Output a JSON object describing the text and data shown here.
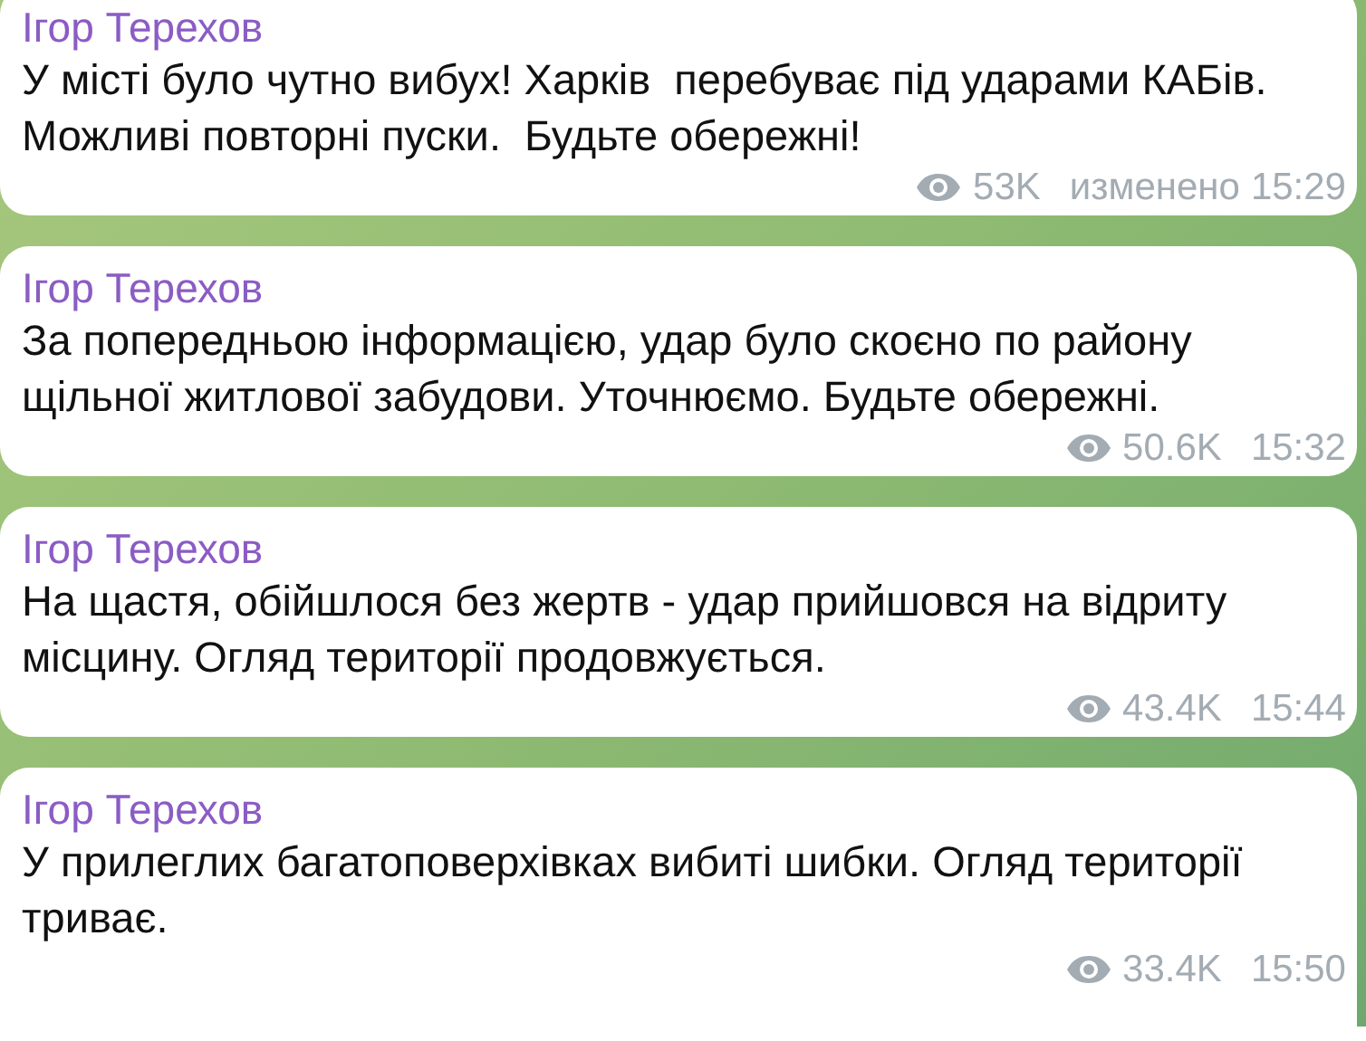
{
  "messages": [
    {
      "author": "Ігор Терехов",
      "text": "У місті було чутно вибух! Харків  перебуває під ударами КАБів.\nМожливі повторні пуски.  Будьте обережні!",
      "views": "53K",
      "edited_label": "изменено",
      "time": "15:29"
    },
    {
      "author": "Ігор Терехов",
      "text": "За попередньою інформацією, удар було скоєно по району\nщільної житлової забудови. Уточнюємо. Будьте обережні.",
      "views": "50.6K",
      "time": "15:32"
    },
    {
      "author": "Ігор Терехов",
      "text": "На щастя, обійшлося без жертв - удар прийшовся на відриту\nмісцину. Огляд території продовжується.",
      "views": "43.4K",
      "time": "15:44"
    },
    {
      "author": "Ігор Терехов",
      "text": "У прилеглих багатоповерхівках вибиті шибки. Огляд території\nтриває.",
      "views": "33.4K",
      "time": "15:50"
    }
  ]
}
